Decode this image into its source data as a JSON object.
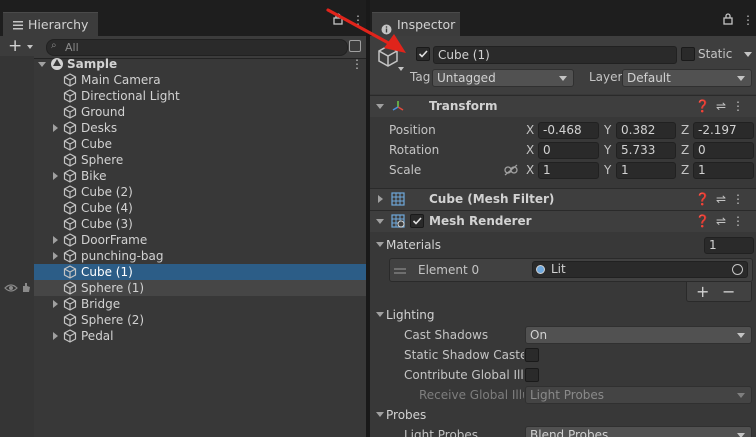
{
  "hierarchy": {
    "tab_label": "Hierarchy",
    "search_placeholder": "All",
    "add_label": "+",
    "scene_name": "Sample",
    "items": [
      {
        "label": "Main Camera",
        "has_children": false,
        "selected": false
      },
      {
        "label": "Directional Light",
        "has_children": false,
        "selected": false
      },
      {
        "label": "Ground",
        "has_children": false,
        "selected": false
      },
      {
        "label": "Desks",
        "has_children": true,
        "selected": false
      },
      {
        "label": "Cube",
        "has_children": false,
        "selected": false
      },
      {
        "label": "Sphere",
        "has_children": false,
        "selected": false
      },
      {
        "label": "Bike",
        "has_children": true,
        "selected": false
      },
      {
        "label": "Cube (2)",
        "has_children": false,
        "selected": false
      },
      {
        "label": "Cube (4)",
        "has_children": false,
        "selected": false
      },
      {
        "label": "Cube (3)",
        "has_children": false,
        "selected": false
      },
      {
        "label": "DoorFrame",
        "has_children": true,
        "selected": false
      },
      {
        "label": "punching-bag",
        "has_children": true,
        "selected": false
      },
      {
        "label": "Cube (1)",
        "has_children": false,
        "selected": true
      },
      {
        "label": "Sphere (1)",
        "has_children": false,
        "selected": false
      },
      {
        "label": "Bridge",
        "has_children": true,
        "selected": false
      },
      {
        "label": "Sphere (2)",
        "has_children": false,
        "selected": false
      },
      {
        "label": "Pedal",
        "has_children": true,
        "selected": false
      }
    ]
  },
  "inspector": {
    "tab_label": "Inspector",
    "object_name": "Cube (1)",
    "static_label": "Static",
    "tag_label": "Tag",
    "tag_value": "Untagged",
    "layer_label": "Layer",
    "layer_value": "Default",
    "transform": {
      "title": "Transform",
      "position_label": "Position",
      "rotation_label": "Rotation",
      "scale_label": "Scale",
      "position": {
        "x": "-0.468",
        "y": "0.382",
        "z": "-2.197"
      },
      "rotation": {
        "x": "0",
        "y": "5.733",
        "z": "0"
      },
      "scale": {
        "x": "1",
        "y": "1",
        "z": "1"
      },
      "axis_x": "X",
      "axis_y": "Y",
      "axis_z": "Z"
    },
    "mesh_filter": {
      "title": "Cube (Mesh Filter)"
    },
    "mesh_renderer": {
      "title": "Mesh Renderer",
      "materials_label": "Materials",
      "materials_count": "1",
      "element0_label": "Element 0",
      "element0_value": "Lit",
      "plus_label": "+",
      "minus_label": "−",
      "lighting_label": "Lighting",
      "cast_shadows_label": "Cast Shadows",
      "cast_shadows_value": "On",
      "static_shadow_label": "Static Shadow Caster",
      "contribute_gi_label": "Contribute Global Illumination",
      "receive_gi_label": "Receive Global Illumination",
      "receive_gi_value": "Light Probes",
      "probes_label": "Probes",
      "light_probes_label": "Light Probes",
      "light_probes_value": "Blend Probes"
    }
  },
  "colors": {
    "selection": "#2c5d87",
    "arrow": "#e0241b",
    "panel": "#383838"
  }
}
